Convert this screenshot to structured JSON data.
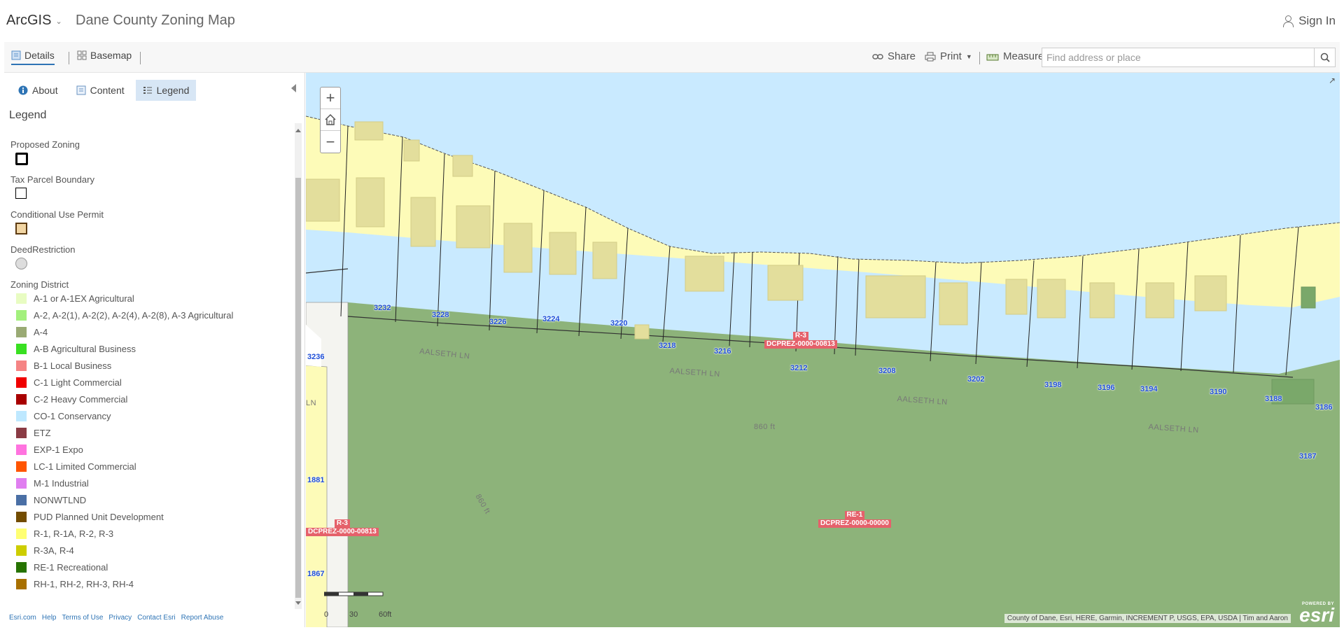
{
  "header": {
    "brand": "ArcGIS",
    "title": "Dane County Zoning Map",
    "signin": "Sign In"
  },
  "toolbar": {
    "details": "Details",
    "basemap": "Basemap",
    "share": "Share",
    "print": "Print",
    "measure": "Measure",
    "search_placeholder": "Find address or place"
  },
  "panel": {
    "tabs": {
      "about": "About",
      "content": "Content",
      "legend": "Legend"
    },
    "legend_title": "Legend",
    "sections": {
      "proposed": "Proposed Zoning",
      "tax_parcel": "Tax Parcel Boundary",
      "cup": "Conditional Use Permit",
      "deed": "DeedRestriction",
      "zoning": "Zoning District"
    },
    "zones": [
      {
        "label": "A-1 or A-1EX Agricultural",
        "color": "#e8fcc2"
      },
      {
        "label": "A-2, A-2(1), A-2(2), A-2(4), A-2(8), A-3 Agricultural",
        "color": "#a3f07d"
      },
      {
        "label": "A-4",
        "color": "#9aaa74"
      },
      {
        "label": "A-B Agricultural Business",
        "color": "#39e022"
      },
      {
        "label": "B-1 Local Business",
        "color": "#f58484"
      },
      {
        "label": "C-1 Light Commercial",
        "color": "#f00000"
      },
      {
        "label": "C-2 Heavy Commercial",
        "color": "#a80000"
      },
      {
        "label": "CO-1 Conservancy",
        "color": "#bee8ff"
      },
      {
        "label": "ETZ",
        "color": "#8a3b44"
      },
      {
        "label": "EXP-1 Expo",
        "color": "#ff73df"
      },
      {
        "label": "LC-1 Limited Commercial",
        "color": "#ff5500"
      },
      {
        "label": "M-1 Industrial",
        "color": "#e07ef0"
      },
      {
        "label": "NONWTLND",
        "color": "#4a6fa5"
      },
      {
        "label": "PUD Planned Unit Development",
        "color": "#734c00"
      },
      {
        "label": "R-1, R-1A, R-2, R-3",
        "color": "#ffff73"
      },
      {
        "label": "R-3A, R-4",
        "color": "#cdcd00"
      },
      {
        "label": "RE-1 Recreational",
        "color": "#267300"
      },
      {
        "label": "RH-1, RH-2, RH-3, RH-4",
        "color": "#a87000"
      }
    ],
    "footer": [
      "Esri.com",
      "Help",
      "Terms of Use",
      "Privacy",
      "Contact Esri",
      "Report Abuse"
    ]
  },
  "map": {
    "attribution": "County of Dane, Esri, HERE, Garmin, INCREMENT P, USGS, EPA, USDA | Tim and Aaron",
    "esri_powered": "POWERED BY",
    "esri_word": "esri",
    "scale_labels": [
      "0",
      "30",
      "60ft"
    ],
    "parcel_numbers": [
      "3232",
      "3228",
      "3226",
      "3224",
      "3220",
      "3218",
      "3216",
      "3212",
      "3208",
      "3202",
      "3198",
      "3196",
      "3194",
      "3190",
      "3188",
      "3186",
      "3236",
      "1881",
      "1867",
      "3187"
    ],
    "street_labels": [
      "AALSETH LN",
      "AALSETH LN",
      "AALSETH LN",
      "AALSETH LN",
      "LN",
      "860 ft",
      "860 ft"
    ],
    "zone_labels": [
      {
        "zone": "R-3",
        "case": "DCPREZ-0000-00813"
      },
      {
        "zone": "R-3",
        "case": "DCPREZ-0000-00813"
      },
      {
        "zone": "RE-1",
        "case": "DCPREZ-0000-00000"
      }
    ],
    "colors": {
      "water": "#c9eaff",
      "residential": "#fdfbb8",
      "recreational": "#8db37a",
      "road": "#f4f4f0"
    }
  }
}
